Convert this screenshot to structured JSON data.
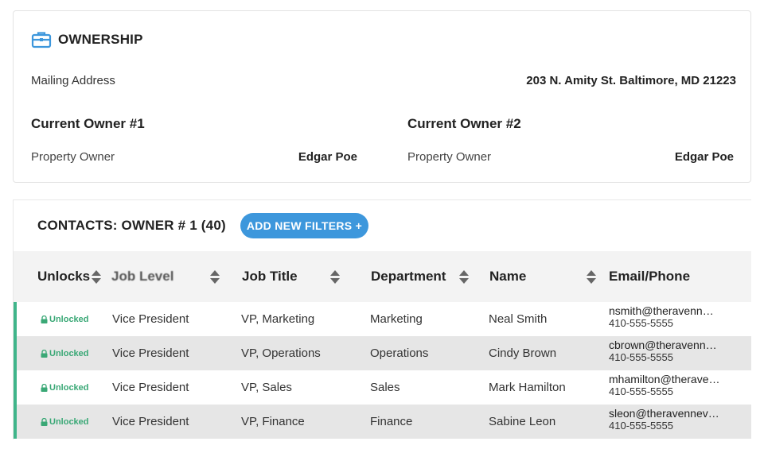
{
  "ownership": {
    "title": "OWNERSHIP",
    "mailing_label": "Mailing Address",
    "mailing_value": "203 N. Amity St. Baltimore, MD 21223",
    "owners": [
      {
        "heading": "Current Owner #1",
        "label": "Property Owner",
        "name": "Edgar Poe"
      },
      {
        "heading": "Current Owner #2",
        "label": "Property Owner",
        "name": "Edgar Poe"
      }
    ]
  },
  "contacts": {
    "title": "CONTACTS: OWNER # 1 (40)",
    "add_filter_label": "ADD NEW FILTERS +",
    "columns": [
      "Unlocks",
      "Job Level",
      "Job Title",
      "Department",
      "Name",
      "Email/Phone"
    ],
    "rows": [
      {
        "unlock": "Unlocked",
        "level": "Vice President",
        "title": "VP, Marketing",
        "dept": "Marketing",
        "name": "Neal Smith",
        "email": "nsmith@theravenn…",
        "phone": "410-555-5555"
      },
      {
        "unlock": "Unlocked",
        "level": "Vice President",
        "title": "VP, Operations",
        "dept": "Operations",
        "name": "Cindy Brown",
        "email": "cbrown@theravenn…",
        "phone": "410-555-5555"
      },
      {
        "unlock": "Unlocked",
        "level": "Vice President",
        "title": "VP, Sales",
        "dept": "Sales",
        "name": "Mark Hamilton",
        "email": "mhamilton@therave…",
        "phone": "410-555-5555"
      },
      {
        "unlock": "Unlocked",
        "level": "Vice President",
        "title": "VP, Finance",
        "dept": "Finance",
        "name": "Sabine Leon",
        "email": "sleon@theravennev…",
        "phone": "410-555-5555"
      }
    ]
  },
  "colors": {
    "accent": "#3d97dc",
    "unlocked": "#3aa876",
    "row_border": "#3fb58a"
  }
}
